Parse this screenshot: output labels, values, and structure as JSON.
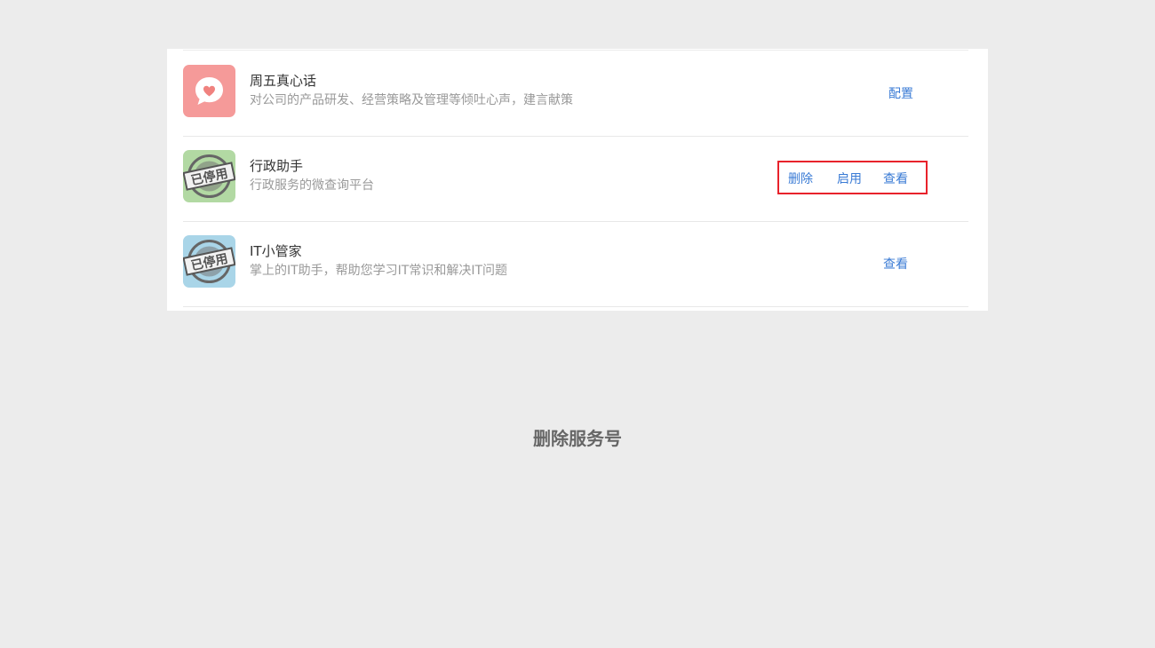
{
  "services": [
    {
      "name": "周五真心话",
      "description": "对公司的产品研发、经营策略及管理等倾吐心声，建言献策",
      "icon": "heart-chat-icon",
      "icon_color": "#f59a99",
      "status": "active",
      "actions": [
        "配置"
      ]
    },
    {
      "name": "行政助手",
      "description": "行政服务的微查询平台",
      "icon": "disabled-stamp-icon",
      "icon_color": "#b2d9a3",
      "status": "disabled",
      "stamp_text": "已停用",
      "actions": [
        "删除",
        "启用",
        "查看"
      ]
    },
    {
      "name": "IT小管家",
      "description": "掌上的IT助手，帮助您学习IT常识和解决IT问题",
      "icon": "disabled-stamp-icon",
      "icon_color": "#a9d5e8",
      "status": "disabled",
      "stamp_text": "已停用",
      "actions": [
        "查看"
      ]
    }
  ],
  "highlight_color": "#e8222b",
  "link_color": "#3a7bd5",
  "caption": "删除服务号"
}
